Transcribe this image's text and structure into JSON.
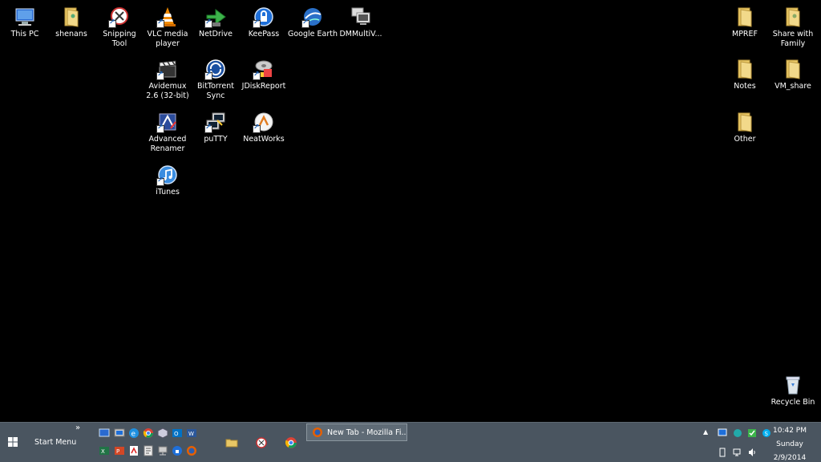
{
  "desktop": {
    "icons": {
      "this_pc": "This PC",
      "shenans": "shenans",
      "snipping_tool": "Snipping Tool",
      "vlc": "VLC media player",
      "netdrive": "NetDrive",
      "keepass": "KeePass",
      "google_earth": "Google Earth",
      "dmmulti": "DMMultiV...",
      "mpref": "MPREF",
      "share_family": "Share with Family",
      "avidemux": "Avidemux 2.6 (32-bit)",
      "bittorrent": "BitTorrent Sync",
      "jdiskreport": "JDiskReport",
      "notes": "Notes",
      "vm_share": "VM_share",
      "adv_renamer": "Advanced Renamer",
      "putty": "puTTY",
      "neatworks": "NeatWorks",
      "other": "Other",
      "itunes": "iTunes",
      "recycle_bin": "Recycle Bin"
    }
  },
  "taskbar": {
    "start_menu_label": "Start Menu",
    "overflow_chevron": "»",
    "tray_chevron": "▲",
    "firefox_task_label": "New Tab - Mozilla Fi...",
    "clock": {
      "time": "10:42 PM",
      "day": "Sunday",
      "date": "2/9/2014"
    }
  },
  "colors": {
    "desktop_bg": "#000000",
    "taskbar_bg": "#4a5560",
    "folder_yellow": "#e8c766",
    "accent_blue": "#1e6fd9"
  }
}
